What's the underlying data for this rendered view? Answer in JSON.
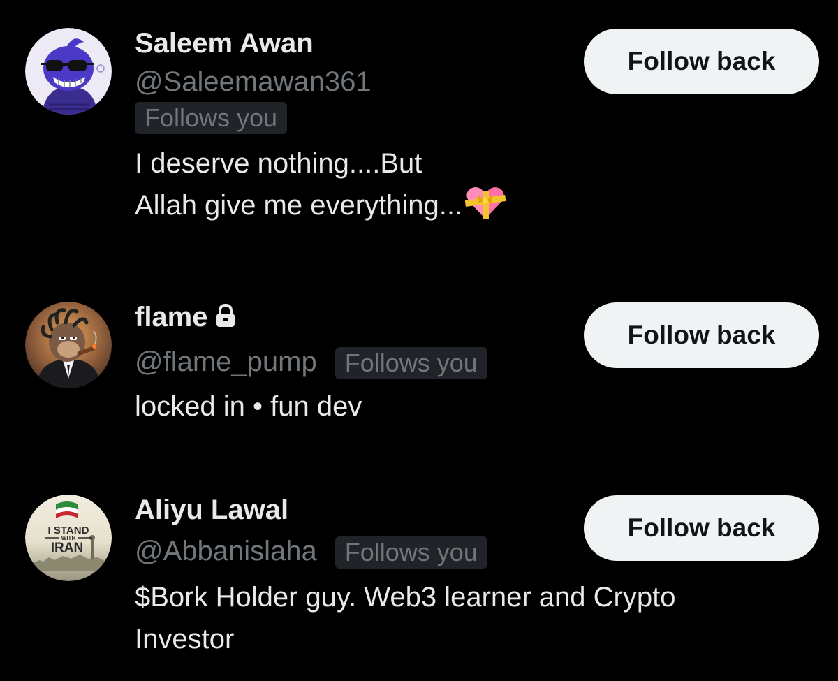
{
  "users": [
    {
      "display_name": "Saleem Awan",
      "handle": "@Saleemawan361",
      "follows_you_label": "Follows you",
      "bio_line1": "I deserve nothing....But",
      "bio_line2": "Allah give me everything...",
      "bio_emoji": "heart-with-ribbon",
      "follow_button_label": "Follow back",
      "avatar": "purple-cartoon-sunglasses"
    },
    {
      "display_name": "flame",
      "protected_icon": "lock-icon",
      "handle": "@flame_pump",
      "follows_you_label": "Follows you",
      "bio": "locked in • fun dev",
      "follow_button_label": "Follow back",
      "avatar": "ape-smoking-cigar"
    },
    {
      "display_name": "Aliyu Lawal",
      "handle": "@Abbanislaha",
      "follows_you_label": "Follows you",
      "bio_line1": "$Bork Holder guy. Web3 learner and Crypto",
      "bio_line2": "Investor",
      "follow_button_label": "Follow back",
      "avatar": "i-stand-with-iran-graphic",
      "avatar_text": [
        "I STAND",
        "WITH",
        "IRAN"
      ]
    }
  ],
  "colors": {
    "background": "#000000",
    "primary_text": "#e7e9ea",
    "secondary_text": "#71767b",
    "badge_bg": "#202327",
    "button_bg": "#eff3f4",
    "button_text": "#0f1419"
  }
}
